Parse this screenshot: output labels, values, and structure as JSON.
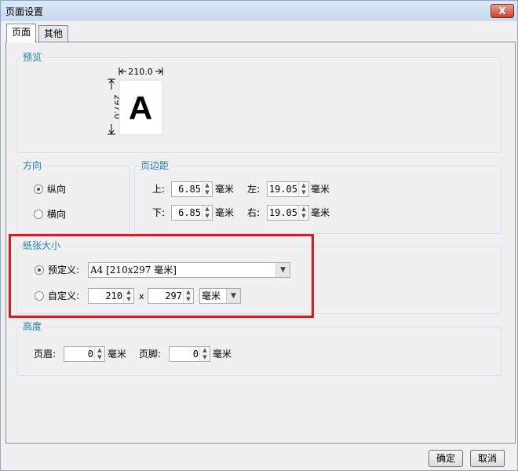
{
  "window": {
    "title": "页面设置",
    "close_label": "X"
  },
  "tabs": [
    {
      "label": "页面",
      "active": true
    },
    {
      "label": "其他",
      "active": false
    }
  ],
  "preview": {
    "title": "预览",
    "width_label": "210.0",
    "height_label": "297.0",
    "sample_letter": "A"
  },
  "orientation": {
    "title": "方向",
    "portrait_label": "纵向",
    "landscape_label": "横向",
    "selected": "portrait"
  },
  "margins": {
    "title": "页边距",
    "top_label": "上:",
    "top_value": "6.85",
    "left_label": "左:",
    "left_value": "19.05",
    "bottom_label": "下:",
    "bottom_value": "6.85",
    "right_label": "右:",
    "right_value": "19.05",
    "unit": "毫米"
  },
  "paper_size": {
    "title": "纸张大小",
    "predefined_label": "预定义:",
    "predefined_value": "A4 [210x297 毫米]",
    "custom_label": "自定义:",
    "custom_width": "210",
    "x_separator": "x",
    "custom_height": "297",
    "custom_unit": "毫米",
    "selected": "predefined"
  },
  "height": {
    "title": "高度",
    "header_label": "页眉:",
    "header_value": "0",
    "footer_label": "页脚:",
    "footer_value": "0",
    "unit": "毫米"
  },
  "buttons": {
    "ok_label": "确定",
    "cancel_label": "取消"
  },
  "colors": {
    "group_title": "#1e7ebf",
    "highlight_box": "#e8151b"
  }
}
